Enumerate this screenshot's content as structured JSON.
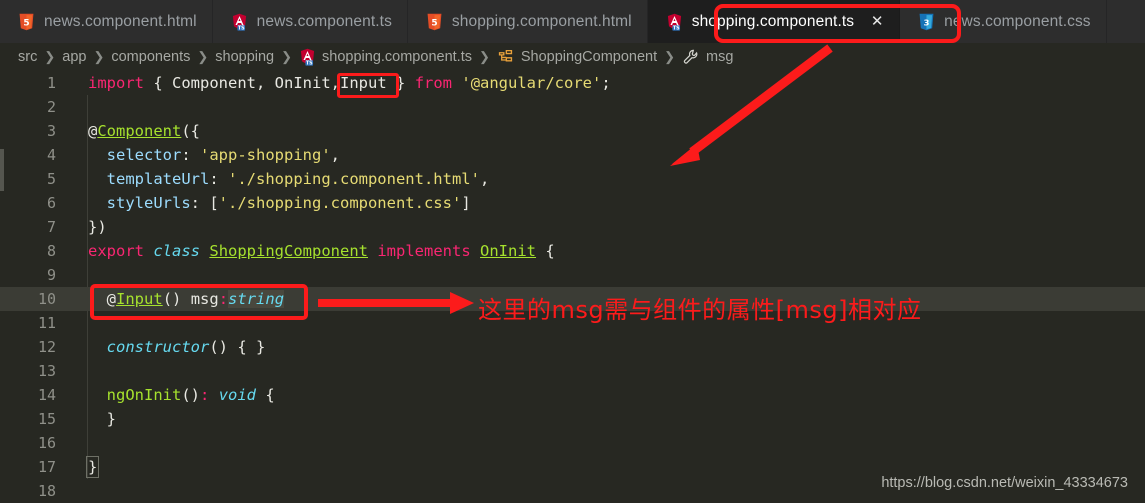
{
  "theme": {
    "editor_bg": "#272822",
    "tabbar_bg": "#2d2d2d",
    "active_tab_bg": "#1e1e1e",
    "current_line_bg": "#3b3c35",
    "annotation_red": "#fc1b1b",
    "keyword": "#f92672",
    "type_green": "#a6e22e",
    "italic_blue": "#66d9ef",
    "string_yellow": "#e6db74",
    "line_number": "#8f9089"
  },
  "tabs": [
    {
      "label": "news.component.html",
      "icon": "html5-file-icon",
      "active": false,
      "closable": false
    },
    {
      "label": "news.component.ts",
      "icon": "angular-ts-file-icon",
      "active": false,
      "closable": false
    },
    {
      "label": "shopping.component.html",
      "icon": "html5-file-icon",
      "active": false,
      "closable": false
    },
    {
      "label": "shopping.component.ts",
      "icon": "angular-ts-file-icon",
      "active": true,
      "closable": true,
      "close_label": "✕"
    },
    {
      "label": "news.component.css",
      "icon": "css3-file-icon",
      "active": false,
      "closable": false
    }
  ],
  "breadcrumb": {
    "separator": "❯",
    "items": [
      {
        "label": "src",
        "icon": ""
      },
      {
        "label": "app",
        "icon": ""
      },
      {
        "label": "components",
        "icon": ""
      },
      {
        "label": "shopping",
        "icon": ""
      },
      {
        "label": "shopping.component.ts",
        "icon": "angular-ts-file-icon"
      },
      {
        "label": "ShoppingComponent",
        "icon": "class-symbol-icon"
      },
      {
        "label": "msg",
        "icon": "property-wrench-icon"
      }
    ]
  },
  "code": {
    "lines": [
      {
        "n": "1",
        "current": false,
        "tokens": [
          {
            "t": "import",
            "c": "t-kw"
          },
          {
            "t": " { ",
            "c": "t-plain"
          },
          {
            "t": "Component",
            "c": "t-plain"
          },
          {
            "t": ", ",
            "c": "t-plain"
          },
          {
            "t": "OnInit",
            "c": "t-plain"
          },
          {
            "t": ",",
            "c": "t-plain"
          },
          {
            "t": "Input",
            "c": "t-plain"
          },
          {
            "t": " } ",
            "c": "t-plain"
          },
          {
            "t": "from",
            "c": "t-kw"
          },
          {
            "t": " ",
            "c": "t-plain"
          },
          {
            "t": "'@angular/core'",
            "c": "t-str"
          },
          {
            "t": ";",
            "c": "t-plain"
          }
        ]
      },
      {
        "n": "2",
        "current": false,
        "tokens": []
      },
      {
        "n": "3",
        "current": false,
        "tokens": [
          {
            "t": "@",
            "c": "t-plain"
          },
          {
            "t": "Component",
            "c": "t-type"
          },
          {
            "t": "({",
            "c": "t-plain"
          }
        ]
      },
      {
        "n": "4",
        "current": false,
        "tokens": [
          {
            "t": "  ",
            "c": "t-plain"
          },
          {
            "t": "selector",
            "c": "t-prop"
          },
          {
            "t": ": ",
            "c": "t-plain"
          },
          {
            "t": "'app-shopping'",
            "c": "t-str"
          },
          {
            "t": ",",
            "c": "t-plain"
          }
        ]
      },
      {
        "n": "5",
        "current": false,
        "tokens": [
          {
            "t": "  ",
            "c": "t-plain"
          },
          {
            "t": "templateUrl",
            "c": "t-prop"
          },
          {
            "t": ": ",
            "c": "t-plain"
          },
          {
            "t": "'./shopping.component.html'",
            "c": "t-str"
          },
          {
            "t": ",",
            "c": "t-plain"
          }
        ]
      },
      {
        "n": "6",
        "current": false,
        "tokens": [
          {
            "t": "  ",
            "c": "t-plain"
          },
          {
            "t": "styleUrls",
            "c": "t-prop"
          },
          {
            "t": ": [",
            "c": "t-plain"
          },
          {
            "t": "'./shopping.component.css'",
            "c": "t-str"
          },
          {
            "t": "]",
            "c": "t-plain"
          }
        ]
      },
      {
        "n": "7",
        "current": false,
        "tokens": [
          {
            "t": "})",
            "c": "t-plain"
          }
        ]
      },
      {
        "n": "8",
        "current": false,
        "tokens": [
          {
            "t": "export",
            "c": "t-kw"
          },
          {
            "t": " ",
            "c": "t-plain"
          },
          {
            "t": "class",
            "c": "t-ital"
          },
          {
            "t": " ",
            "c": "t-plain"
          },
          {
            "t": "ShoppingComponent",
            "c": "t-type"
          },
          {
            "t": " ",
            "c": "t-plain"
          },
          {
            "t": "implements",
            "c": "t-kw"
          },
          {
            "t": " ",
            "c": "t-plain"
          },
          {
            "t": "OnInit",
            "c": "t-type"
          },
          {
            "t": " {",
            "c": "t-plain"
          }
        ]
      },
      {
        "n": "9",
        "current": false,
        "tokens": []
      },
      {
        "n": "10",
        "current": true,
        "tokens": [
          {
            "t": "  ",
            "c": "t-plain"
          },
          {
            "t": "@",
            "c": "t-plain"
          },
          {
            "t": "Input",
            "c": "t-type"
          },
          {
            "t": "() ",
            "c": "t-plain"
          },
          {
            "t": "msg",
            "c": "t-plain"
          },
          {
            "t": ":",
            "c": "t-colon"
          },
          {
            "t": "string",
            "c": "t-ital sel"
          }
        ]
      },
      {
        "n": "11",
        "current": false,
        "tokens": []
      },
      {
        "n": "12",
        "current": false,
        "tokens": [
          {
            "t": "  ",
            "c": "t-plain"
          },
          {
            "t": "constructor",
            "c": "t-ital"
          },
          {
            "t": "() { }",
            "c": "t-plain"
          }
        ]
      },
      {
        "n": "13",
        "current": false,
        "tokens": []
      },
      {
        "n": "14",
        "current": false,
        "tokens": [
          {
            "t": "  ",
            "c": "t-plain"
          },
          {
            "t": "ngOnInit",
            "c": "t-fn"
          },
          {
            "t": "()",
            "c": "t-plain"
          },
          {
            "t": ":",
            "c": "t-colon"
          },
          {
            "t": " ",
            "c": "t-plain"
          },
          {
            "t": "void",
            "c": "t-ital"
          },
          {
            "t": " {",
            "c": "t-plain"
          }
        ]
      },
      {
        "n": "15",
        "current": false,
        "tokens": [
          {
            "t": "  }",
            "c": "t-plain"
          }
        ]
      },
      {
        "n": "16",
        "current": false,
        "tokens": []
      },
      {
        "n": "17",
        "current": false,
        "tokens": [
          {
            "t": "}",
            "c": "t-plain bracket-box"
          }
        ]
      },
      {
        "n": "18",
        "current": false,
        "tokens": []
      }
    ]
  },
  "annotations": {
    "note_text": "这里的msg需与组件的属性[msg]相对应",
    "highlight_tab": "shopping.component.ts",
    "highlight_token_import": "Input",
    "highlight_line": "10"
  },
  "watermark": {
    "text": "https://blog.csdn.net/weixin_43334673"
  }
}
